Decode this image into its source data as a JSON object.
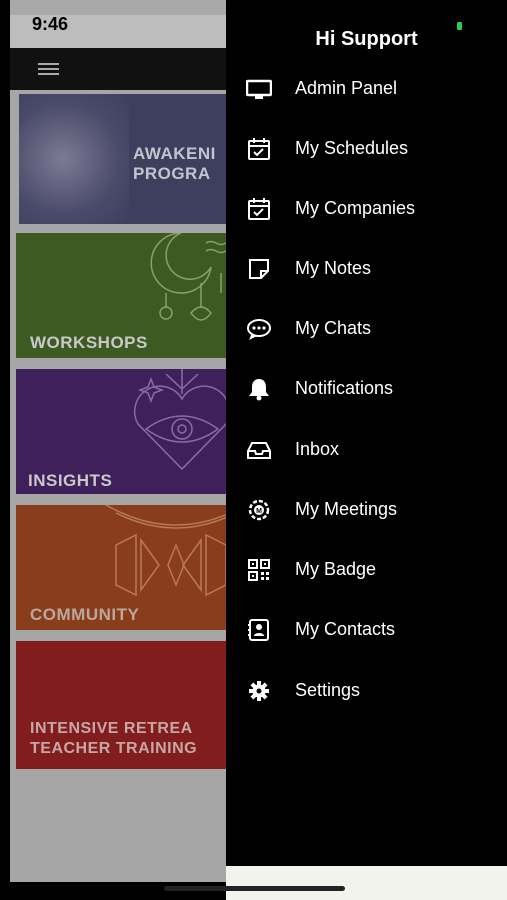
{
  "status_bar": {
    "time": "9:46"
  },
  "drawer": {
    "title": "Hi Support",
    "items": [
      {
        "label": "Admin Panel",
        "icon": "monitor-icon"
      },
      {
        "label": "My Schedules",
        "icon": "calendar-check-icon"
      },
      {
        "label": "My Companies",
        "icon": "calendar-check-icon"
      },
      {
        "label": "My Notes",
        "icon": "note-icon"
      },
      {
        "label": "My Chats",
        "icon": "chat-bubble-icon"
      },
      {
        "label": "Notifications",
        "icon": "bell-icon"
      },
      {
        "label": "Inbox",
        "icon": "inbox-tray-icon"
      },
      {
        "label": "My Meetings",
        "icon": "meetings-icon"
      },
      {
        "label": "My Badge",
        "icon": "qr-code-icon"
      },
      {
        "label": "My Contacts",
        "icon": "contact-card-icon"
      },
      {
        "label": "Settings",
        "icon": "gear-icon"
      }
    ]
  },
  "background": {
    "cards": {
      "awakening": "AWAKENI\nPROGRA",
      "workshops": "WORKSHOPS",
      "insights": "INSIGHTS",
      "community": "COMMUNITY",
      "retreat": "INTENSIVE RETREA\nTEACHER TRAINING"
    }
  },
  "colors": {
    "drawer_bg": "#000000",
    "workshops": "#3d5a22",
    "insights": "#40205a",
    "community": "#8a3d1a",
    "retreat": "#811e1d"
  }
}
